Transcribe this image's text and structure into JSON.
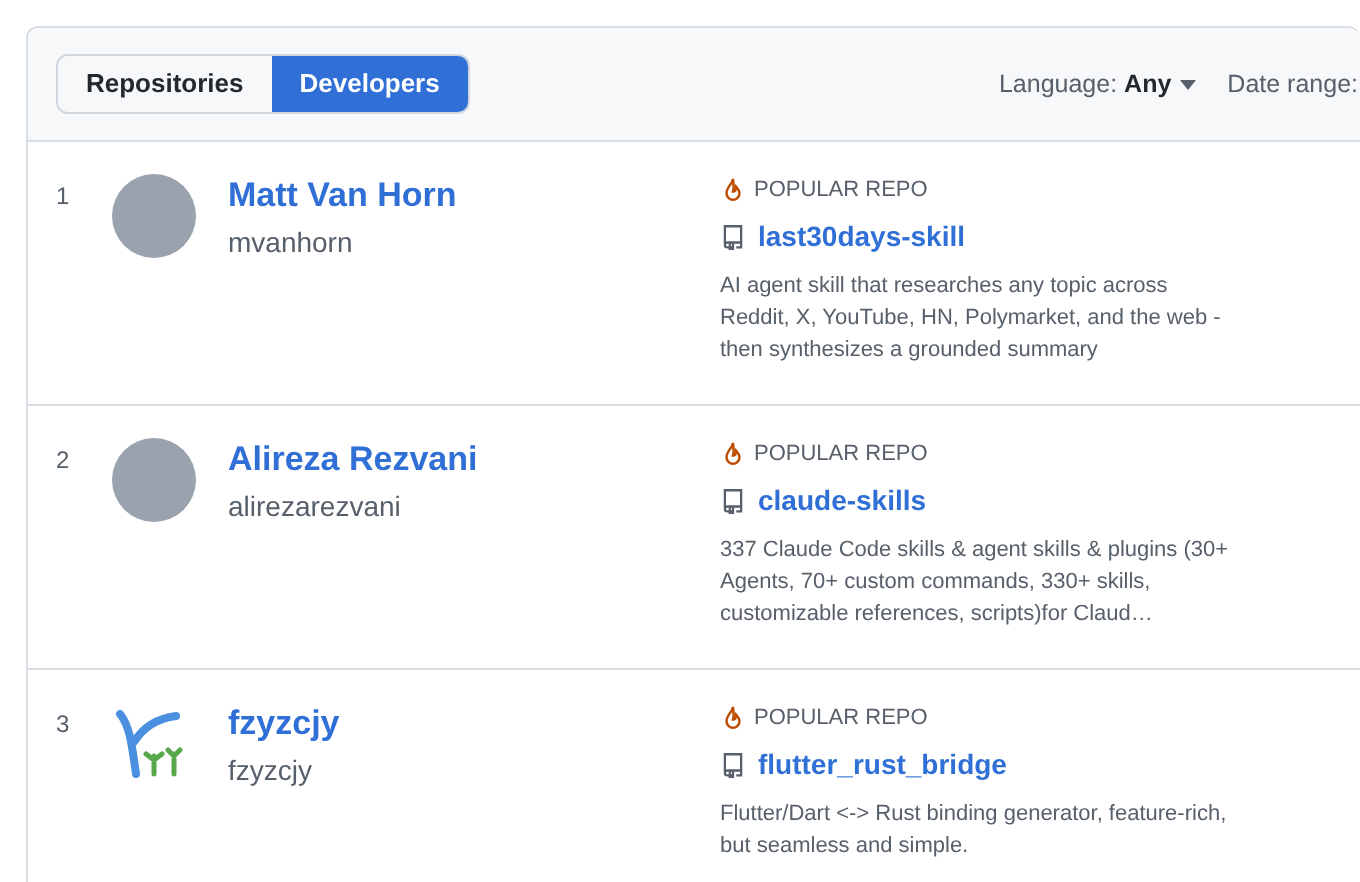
{
  "tabs": [
    {
      "label": "Repositories",
      "selected": false
    },
    {
      "label": "Developers",
      "selected": true
    }
  ],
  "filters": [
    {
      "label": "Language:",
      "value": "Any",
      "dropdown": true
    },
    {
      "label": "Date range:",
      "dropdown": false
    }
  ],
  "developers": [
    {
      "rank": "1",
      "avatar": {
        "kind": "photo"
      },
      "name": "Matt Van Horn",
      "username": "mvanhorn",
      "badge": "POPULAR REPO",
      "repo": "last30days-skill",
      "description": "AI agent skill that researches any topic across Reddit, X, YouTube, HN, Polymarket, and the web - then synthesizes a grounded summary"
    },
    {
      "rank": "2",
      "avatar": {
        "kind": "photo"
      },
      "name": "Alireza Rezvani",
      "username": "alirezarezvani",
      "badge": "POPULAR REPO",
      "repo": "claude-skills",
      "description": "337 Claude Code skills & agent skills & plugins (30+ Agents, 70+ custom commands, 330+ skills, customizable references, scripts)for Claud…"
    },
    {
      "rank": "3",
      "avatar": {
        "kind": "logo"
      },
      "name": "fzyzcjy",
      "username": "fzyzcjy",
      "badge": "POPULAR REPO",
      "repo": "flutter_rust_bridge",
      "description": "Flutter/Dart <-> Rust binding generator, feature-rich, but seamless and simple."
    }
  ]
}
